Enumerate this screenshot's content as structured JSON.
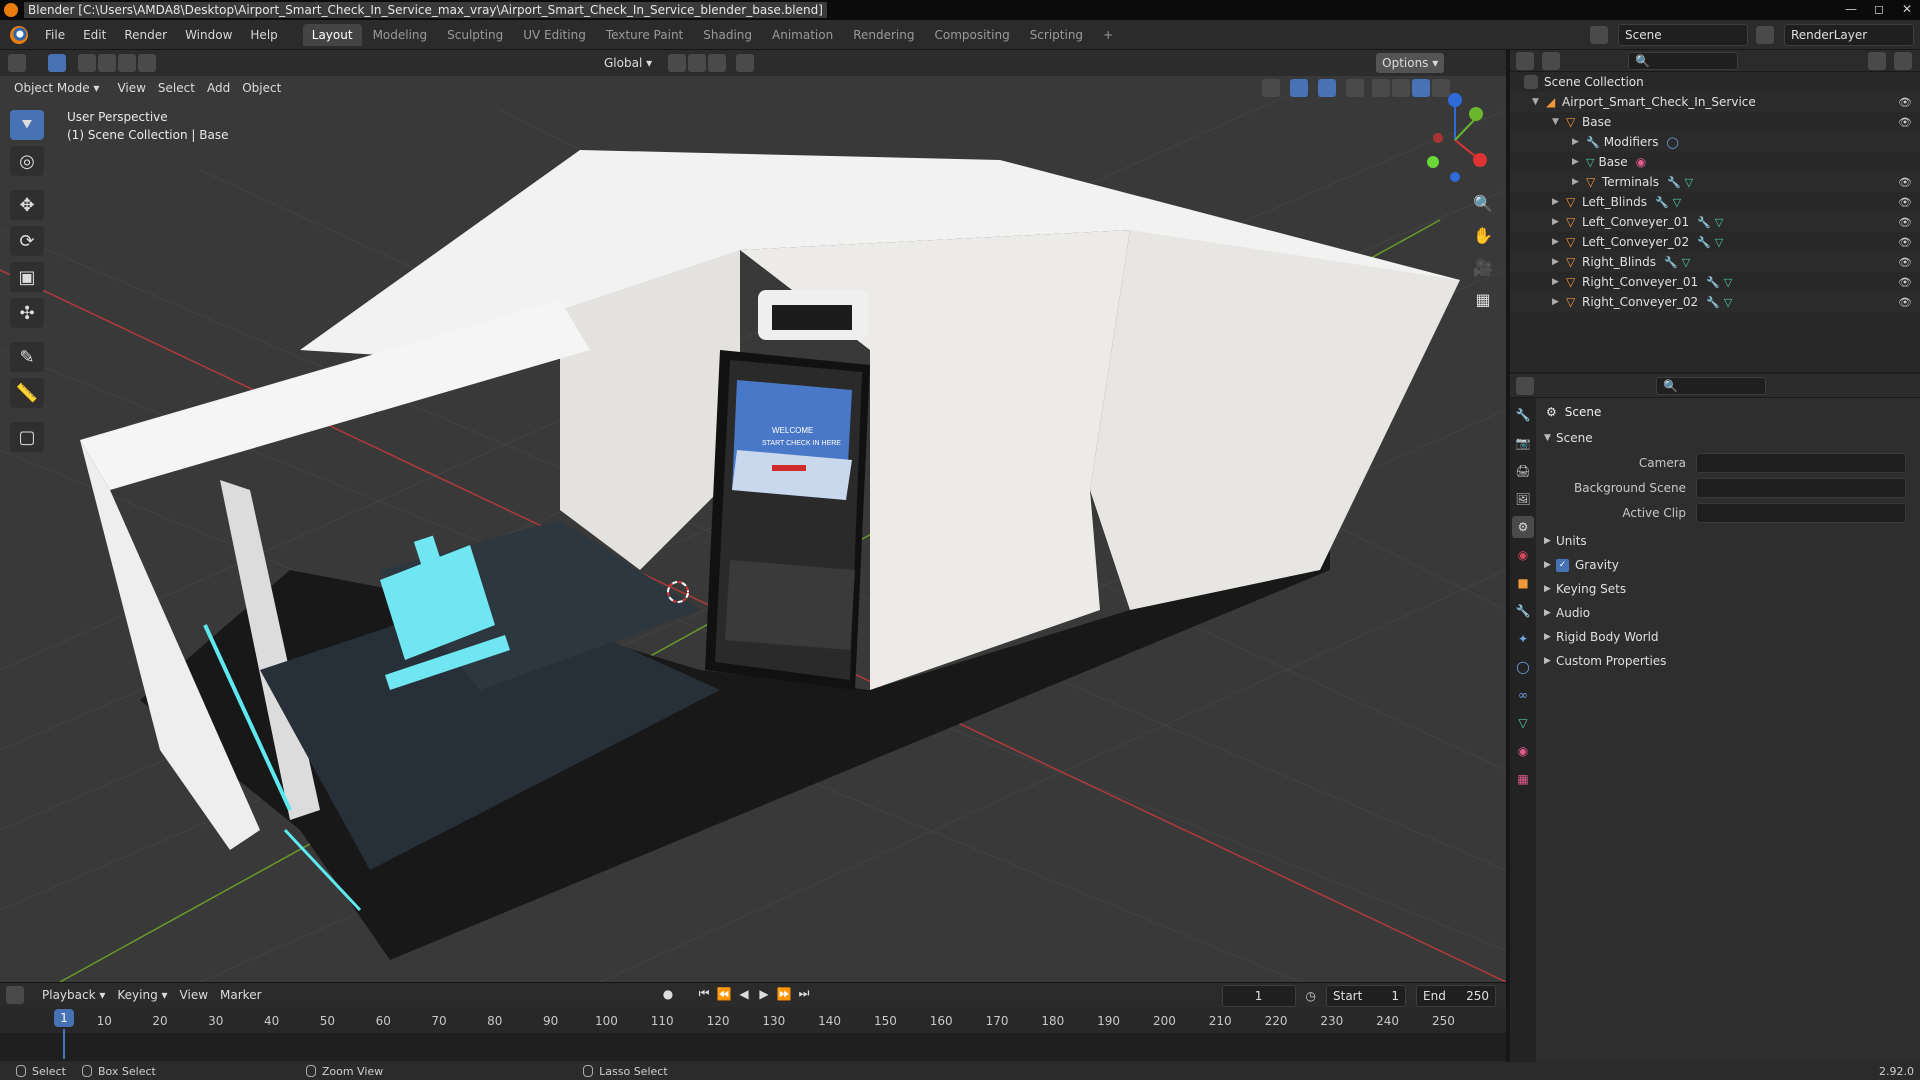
{
  "window": {
    "title": "Blender [C:\\Users\\AMDA8\\Desktop\\Airport_Smart_Check_In_Service_max_vray\\Airport_Smart_Check_In_Service_blender_base.blend]"
  },
  "menu": {
    "items": [
      "File",
      "Edit",
      "Render",
      "Window",
      "Help"
    ]
  },
  "workspaces": {
    "tabs": [
      "Layout",
      "Modeling",
      "Sculpting",
      "UV Editing",
      "Texture Paint",
      "Shading",
      "Animation",
      "Rendering",
      "Compositing",
      "Scripting"
    ],
    "active": "Layout",
    "add": "+"
  },
  "top_right": {
    "scene": "Scene",
    "view_layer": "RenderLayer"
  },
  "viewport": {
    "orientation": "Global",
    "options": "Options",
    "mode": "Object Mode",
    "menus": [
      "View",
      "Select",
      "Add",
      "Object"
    ],
    "perspective": "User Perspective",
    "collection": "(1) Scene Collection | Base",
    "screen_welcome": "WELCOME",
    "screen_sub": "START CHECK IN HERE"
  },
  "outliner": {
    "root": "Scene Collection",
    "items": [
      {
        "label": "Airport_Smart_Check_In_Service",
        "indent": 1,
        "type": "collection"
      },
      {
        "label": "Base",
        "indent": 2,
        "type": "object"
      },
      {
        "label": "Modifiers",
        "indent": 3,
        "type": "modifiers"
      },
      {
        "label": "Base",
        "indent": 3,
        "type": "mesh"
      },
      {
        "label": "Terminals",
        "indent": 3,
        "type": "object"
      },
      {
        "label": "Left_Blinds",
        "indent": 2,
        "type": "object"
      },
      {
        "label": "Left_Conveyer_01",
        "indent": 2,
        "type": "object"
      },
      {
        "label": "Left_Conveyer_02",
        "indent": 2,
        "type": "object"
      },
      {
        "label": "Right_Blinds",
        "indent": 2,
        "type": "object"
      },
      {
        "label": "Right_Conveyer_01",
        "indent": 2,
        "type": "object"
      },
      {
        "label": "Right_Conveyer_02",
        "indent": 2,
        "type": "object"
      }
    ]
  },
  "properties": {
    "context": "Scene",
    "panel": "Scene",
    "camera_label": "Camera",
    "background_label": "Background Scene",
    "clip_label": "Active Clip",
    "sections": [
      "Units",
      "Gravity",
      "Keying Sets",
      "Audio",
      "Rigid Body World",
      "Custom Properties"
    ],
    "gravity_checked": true
  },
  "timeline": {
    "menus": [
      "Playback",
      "Keying",
      "View",
      "Marker"
    ],
    "current_frame": "1",
    "start_label": "Start",
    "start": "1",
    "end_label": "End",
    "end": "250",
    "ticks": [
      "10",
      "20",
      "30",
      "40",
      "50",
      "60",
      "70",
      "80",
      "90",
      "100",
      "110",
      "120",
      "130",
      "140",
      "150",
      "160",
      "170",
      "180",
      "190",
      "200",
      "210",
      "220",
      "230",
      "240",
      "250"
    ]
  },
  "status": {
    "select": "Select",
    "box_select": "Box Select",
    "zoom_view": "Zoom View",
    "lasso_select": "Lasso Select",
    "version": "2.92.0"
  },
  "colors": {
    "accent": "#4772b3",
    "object_orange": "#f0973a",
    "mesh_green": "#4fcfa0",
    "grid_red": "#b03a3a",
    "grid_green": "#6a9a2a"
  }
}
